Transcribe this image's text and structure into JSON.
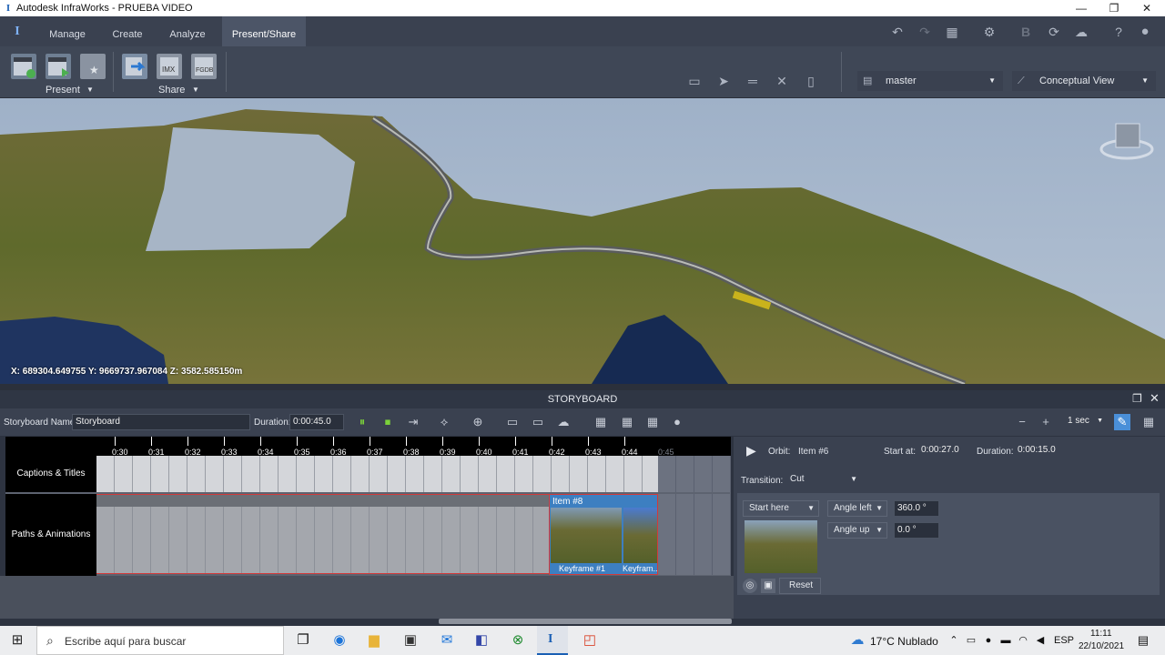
{
  "window": {
    "title": "Autodesk InfraWorks - PRUEBA VIDEO",
    "app_logo": "I",
    "minimize": "—",
    "restore": "❐",
    "close": "✕"
  },
  "ribbon": {
    "tabs": [
      {
        "label": "Manage"
      },
      {
        "label": "Create"
      },
      {
        "label": "Analyze"
      },
      {
        "label": "Present/Share"
      }
    ],
    "active_tab": "Present/Share",
    "groups": {
      "present_label": "Present",
      "share_label": "Share"
    },
    "button_badges": {
      "imx": "IMX",
      "fgdb": "FGDB"
    },
    "proposal": "master",
    "view_style": "Conceptual View",
    "bold_icon_glyph": "B"
  },
  "viewport": {
    "coords": "X: 689304.649755 Y: 9669737.967084 Z: 3582.585150m"
  },
  "storyboard": {
    "header": "STORYBOARD",
    "name_label": "Storyboard Name:",
    "name_value": "Storyboard",
    "duration_label": "Duration:",
    "duration_value": "0:00:45.0",
    "step_value": "1 sec",
    "ruler_ticks": [
      "0:30",
      "0:31",
      "0:32",
      "0:33",
      "0:34",
      "0:35",
      "0:36",
      "0:37",
      "0:38",
      "0:39",
      "0:40",
      "0:41",
      "0:42",
      "0:43",
      "0:44",
      "0:45"
    ],
    "tracks": {
      "captions": "Captions & Titles",
      "paths": "Paths & Animations"
    },
    "item": {
      "title": "Item #8",
      "keyframe1": "Keyframe #1",
      "keyframe2": "Keyfram..."
    }
  },
  "properties": {
    "type_label": "Orbit:",
    "item_value": "Item #6",
    "start_label": "Start at:",
    "start_value": "0:00:27.0",
    "duration_label": "Duration:",
    "duration_value": "0:00:15.0",
    "transition_label": "Transition:",
    "transition_value": "Cut",
    "start_here": "Start here",
    "angle_left_label": "Angle left",
    "angle_left_value": "360.0 °",
    "angle_up_label": "Angle up",
    "angle_up_value": "0.0 °",
    "reset_label": "Reset"
  },
  "taskbar": {
    "search_placeholder": "Escribe aquí para buscar",
    "weather": "17°C  Nublado",
    "lang": "ESP",
    "time": "11:11",
    "date": "22/10/2021"
  },
  "colors": {
    "accent": "#4c5567",
    "clip_blue": "#3d7fc1",
    "playhead_red": "#d23a3a"
  }
}
